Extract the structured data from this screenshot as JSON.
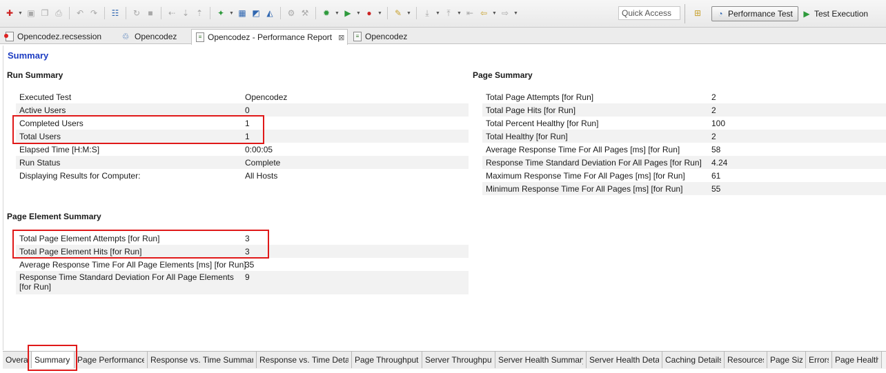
{
  "toolbar": {
    "quick_access_placeholder": "Quick Access",
    "perspectives": [
      {
        "label": "Performance Test",
        "active": true
      },
      {
        "label": "Test Execution",
        "active": false
      }
    ]
  },
  "editor_tabs": [
    {
      "label": "Opencodez.recsession",
      "icon": "recording-session-icon",
      "active": false
    },
    {
      "label": "Opencodez",
      "icon": "test-schedule-icon",
      "active": false
    },
    {
      "label": "Opencodez - Performance Report",
      "icon": "report-icon",
      "active": true
    },
    {
      "label": "Opencodez",
      "icon": "test-file-icon",
      "active": false
    }
  ],
  "report": {
    "title": "Summary",
    "run_summary": {
      "title": "Run Summary",
      "rows": [
        {
          "label": "Executed Test",
          "value": "Opencodez"
        },
        {
          "label": "Active Users",
          "value": "0"
        },
        {
          "label": "Completed Users",
          "value": "1"
        },
        {
          "label": "Total Users",
          "value": "1"
        },
        {
          "label": "Elapsed Time [H:M:S]",
          "value": "0:00:05"
        },
        {
          "label": "Run Status",
          "value": "Complete"
        },
        {
          "label": "Displaying Results for Computer:",
          "value": "All Hosts"
        }
      ]
    },
    "page_summary": {
      "title": "Page Summary",
      "rows": [
        {
          "label": "Total Page Attempts [for Run]",
          "value": "2"
        },
        {
          "label": "Total Page Hits [for Run]",
          "value": "2"
        },
        {
          "label": "Total Percent Healthy [for Run]",
          "value": "100"
        },
        {
          "label": "Total Healthy [for Run]",
          "value": "2"
        },
        {
          "label": "Average Response Time For All Pages [ms] [for Run]",
          "value": "58"
        },
        {
          "label": "Response Time Standard Deviation For All Pages [for Run]",
          "value": "4.24"
        },
        {
          "label": "Maximum Response Time For All Pages [ms] [for Run]",
          "value": "61"
        },
        {
          "label": "Minimum Response Time For All Pages [ms] [for Run]",
          "value": "55"
        }
      ]
    },
    "page_element_summary": {
      "title": "Page Element Summary",
      "rows": [
        {
          "label": "Total Page Element Attempts [for Run]",
          "value": "3"
        },
        {
          "label": "Total Page Element Hits [for Run]",
          "value": "3"
        },
        {
          "label": "Average Response Time For All Page Elements [ms] [for Run]",
          "value": "35"
        },
        {
          "label": "Response Time Standard Deviation For All Page Elements",
          "label_line2": "[for Run]",
          "value": "9"
        }
      ]
    }
  },
  "bottom_tabs": [
    {
      "label": "Overall",
      "active": false
    },
    {
      "label": "Summary",
      "active": true
    },
    {
      "label": "Page Performance",
      "active": false
    },
    {
      "label": "Response vs. Time Summary",
      "active": false
    },
    {
      "label": "Response vs. Time Detail",
      "active": false
    },
    {
      "label": "Page Throughput",
      "active": false
    },
    {
      "label": "Server Throughput",
      "active": false
    },
    {
      "label": "Server Health Summary",
      "active": false
    },
    {
      "label": "Server Health Detail",
      "active": false
    },
    {
      "label": "Caching Details",
      "active": false
    },
    {
      "label": "Resources",
      "active": false
    },
    {
      "label": "Page Size",
      "active": false
    },
    {
      "label": "Errors",
      "active": false
    },
    {
      "label": "Page Health",
      "active": false
    }
  ],
  "colors": {
    "highlight": "#e01818",
    "report_title": "#1c3cc2"
  }
}
